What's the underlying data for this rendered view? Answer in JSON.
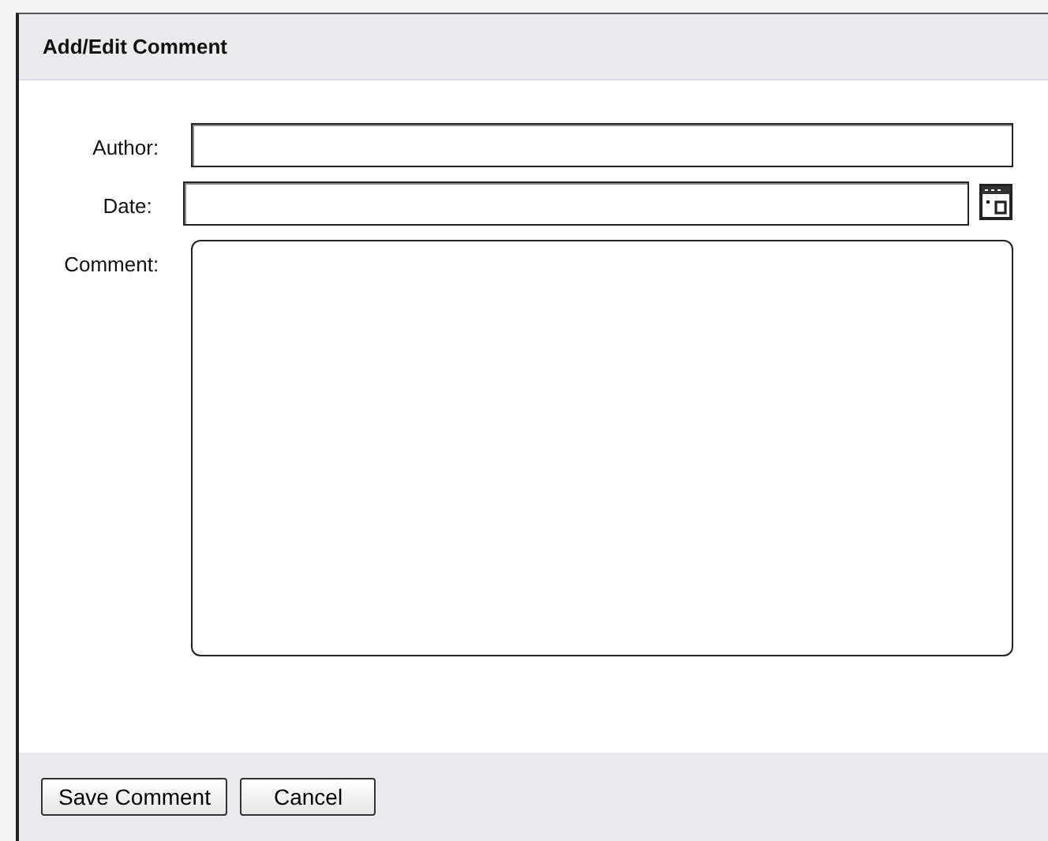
{
  "dialog": {
    "title": "Add/Edit Comment"
  },
  "fields": [
    {
      "kind": "text",
      "label": "Author:"
    },
    {
      "kind": "date",
      "label": "Date:"
    },
    {
      "kind": "textarea",
      "label": "Comment:"
    }
  ],
  "buttons": [
    "Save Comment",
    "Cancel"
  ]
}
